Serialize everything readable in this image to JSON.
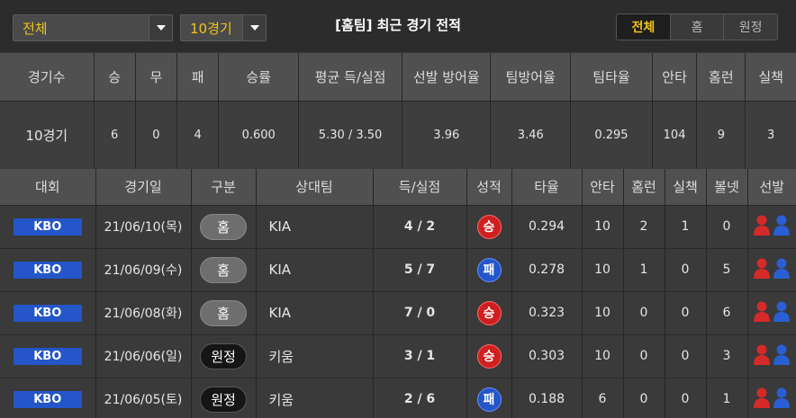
{
  "header": {
    "filter_select": "전체",
    "games_select": "10경기",
    "title": "[홈팀] 최근 경기 전적",
    "segments": [
      "전체",
      "홈",
      "원정"
    ],
    "active_segment": 0
  },
  "summary": {
    "headers": [
      "경기수",
      "승",
      "무",
      "패",
      "승률",
      "평균 득/실점",
      "선발 방어율",
      "팀방어율",
      "팀타율",
      "안타",
      "홈런",
      "실책"
    ],
    "values": [
      "10경기",
      "6",
      "0",
      "4",
      "0.600",
      "5.30 / 3.50",
      "3.96",
      "3.46",
      "0.295",
      "104",
      "9",
      "3"
    ]
  },
  "games": {
    "headers": [
      "대회",
      "경기일",
      "구분",
      "상대팀",
      "득/실점",
      "성적",
      "타율",
      "안타",
      "홈런",
      "실책",
      "볼넷",
      "선발"
    ],
    "rows": [
      {
        "league": "KBO",
        "date": "21/06/10(목)",
        "venue": "홈",
        "venue_type": "home",
        "opponent": "KIA",
        "score": "4 / 2",
        "result": "승",
        "result_type": "win",
        "avg": "0.294",
        "hits": "10",
        "hr": "2",
        "errors": "1",
        "walks": "0"
      },
      {
        "league": "KBO",
        "date": "21/06/09(수)",
        "venue": "홈",
        "venue_type": "home",
        "opponent": "KIA",
        "score": "5 / 7",
        "result": "패",
        "result_type": "lose",
        "avg": "0.278",
        "hits": "10",
        "hr": "1",
        "errors": "0",
        "walks": "5"
      },
      {
        "league": "KBO",
        "date": "21/06/08(화)",
        "venue": "홈",
        "venue_type": "home",
        "opponent": "KIA",
        "score": "7 / 0",
        "result": "승",
        "result_type": "win",
        "avg": "0.323",
        "hits": "10",
        "hr": "0",
        "errors": "0",
        "walks": "6"
      },
      {
        "league": "KBO",
        "date": "21/06/06(일)",
        "venue": "원정",
        "venue_type": "away",
        "opponent": "키움",
        "score": "3 / 1",
        "result": "승",
        "result_type": "win",
        "avg": "0.303",
        "hits": "10",
        "hr": "0",
        "errors": "0",
        "walks": "3"
      },
      {
        "league": "KBO",
        "date": "21/06/05(토)",
        "venue": "원정",
        "venue_type": "away",
        "opponent": "키움",
        "score": "2 / 6",
        "result": "패",
        "result_type": "lose",
        "avg": "0.188",
        "hits": "6",
        "hr": "0",
        "errors": "0",
        "walks": "1"
      }
    ]
  },
  "colors": {
    "accent": "#f0c419",
    "league_badge": "#2456c9",
    "win": "#d01f1f",
    "lose": "#2456c9",
    "home_pitcher_icon": "#d42a2a",
    "away_pitcher_icon": "#2a5fd4"
  },
  "icons": {
    "dropdown": "chevron-down-icon",
    "pitchers": [
      "red-person-icon",
      "blue-person-icon"
    ]
  }
}
